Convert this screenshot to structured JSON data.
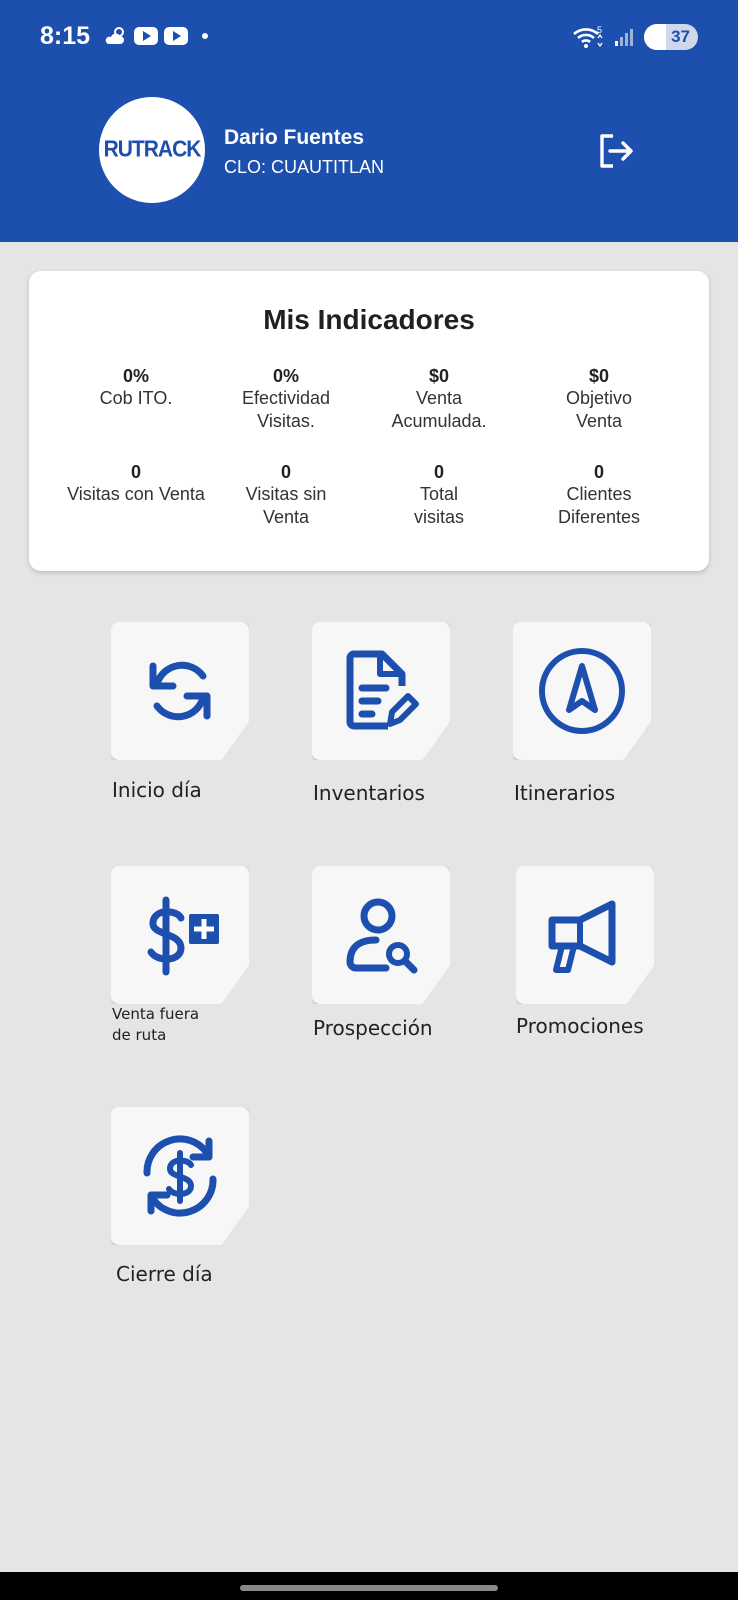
{
  "status_bar": {
    "time": "8:15",
    "battery": "37",
    "icons": [
      "weather-cloud-sun-icon",
      "youtube-icon",
      "youtube-icon",
      "notification-dot-icon",
      "wifi-icon",
      "signal-icon",
      "battery-icon"
    ]
  },
  "header": {
    "logo": "RUTRACK",
    "user_name": "Dario Fuentes",
    "clo": "CLO: CUAUTITLAN",
    "logout_icon": "logout-icon",
    "bg_color": "#1c4fae"
  },
  "indicators": {
    "title": "Mis Indicadores",
    "items": [
      {
        "value": "0%",
        "label": "Cob ITO."
      },
      {
        "value": "0%",
        "label": "Efectividad Visitas."
      },
      {
        "value": "$0",
        "label": "Venta Acumulada."
      },
      {
        "value": "$0",
        "label": "Objetivo Venta"
      },
      {
        "value": "0",
        "label": "Visitas con Venta"
      },
      {
        "value": "0",
        "label": "Visitas sin Venta"
      },
      {
        "value": "0",
        "label": "Total visitas"
      },
      {
        "value": "0",
        "label": "Clientes Diferentes"
      }
    ]
  },
  "menu": {
    "accent_color": "#1c4fae",
    "items": [
      {
        "label": "Inicio día",
        "icon": "sync-icon"
      },
      {
        "label": "Inventarios",
        "icon": "document-edit-icon"
      },
      {
        "label": "Itinerarios",
        "icon": "navigation-icon"
      },
      {
        "label": "Venta fuera de ruta",
        "icon": "dollar-plus-icon"
      },
      {
        "label": "Prospección",
        "icon": "user-search-icon"
      },
      {
        "label": "Promociones",
        "icon": "megaphone-icon"
      },
      {
        "label": "Cierre día",
        "icon": "money-sync-icon"
      }
    ]
  }
}
